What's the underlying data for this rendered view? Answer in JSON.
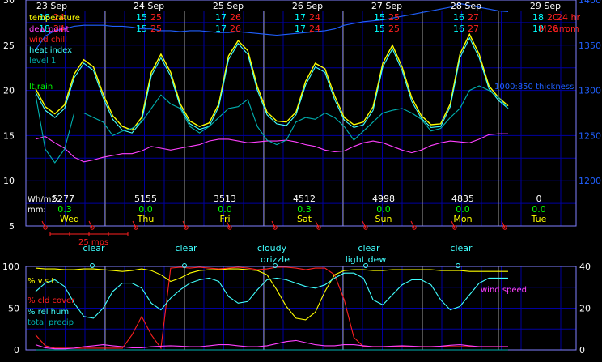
{
  "colors": {
    "background": "#000000",
    "frame": "#8080ff",
    "grid": "#0000a0",
    "day_line": "#a0a0a0",
    "temperature": "#ffff00",
    "dew_point": "#ff40ff",
    "wind_chill": "#ff2020",
    "heat_index": "#40ffff",
    "level1": "#00b0b0",
    "rain": "#00ff00",
    "thickness": "#2060ff",
    "tick_label": "#ffffff",
    "day_label": "#ffff00",
    "min_temp": "#00ffff",
    "max_temp": "#ff2020",
    "cloud_label": "#40ffff"
  },
  "chart_data": [
    {
      "type": "line",
      "title": "",
      "x_days": [
        "23 Sep",
        "24 Sep",
        "25 Sep",
        "26 Sep",
        "27 Sep",
        "28 Sep",
        "29 Sep"
      ],
      "ylim_left": [
        5,
        30
      ],
      "ylim_right": [
        1150,
        1400
      ],
      "left_ticks": [
        "5",
        "10",
        "15",
        "20",
        "25",
        "30"
      ],
      "right_ticks": [
        "1200",
        "1250",
        "1300",
        "1350",
        "1400"
      ],
      "legend": [
        "temperature",
        "dew point",
        "wind chill",
        "heat index",
        "level 1"
      ],
      "rain_label": "lt.rain",
      "thickness_label": "1000:850 thickness",
      "grid": true,
      "daily_min": [
        "18",
        "15",
        "17",
        "17",
        "15",
        "16",
        "18"
      ],
      "daily_max": [
        "24",
        "25",
        "26",
        "24",
        "25",
        "27",
        "20"
      ],
      "hour_modes": [
        "24 hr",
        "M",
        "am",
        "pm"
      ],
      "series": [
        {
          "name": "temperature",
          "values": [
            20.2,
            18.2,
            17.4,
            18.4,
            21.8,
            23.4,
            22.6,
            19.6,
            17.2,
            16.0,
            15.6,
            17.0,
            22.0,
            24.0,
            22.0,
            18.5,
            16.6,
            16.0,
            16.4,
            18.5,
            23.8,
            25.5,
            24.4,
            20.4,
            17.6,
            16.6,
            16.5,
            17.6,
            21.0,
            23.0,
            22.4,
            19.4,
            17.0,
            16.2,
            16.5,
            18.2,
            23.0,
            25.0,
            22.6,
            19.2,
            17.2,
            16.2,
            16.3,
            18.5,
            24.0,
            26.2,
            24.0,
            20.5,
            19.2,
            18.3
          ]
        },
        {
          "name": "dew point",
          "values": [
            14.6,
            14.9,
            14.2,
            13.6,
            12.6,
            12.1,
            12.3,
            12.6,
            12.8,
            13.0,
            13.0,
            13.3,
            13.8,
            13.6,
            13.4,
            13.6,
            13.8,
            14.0,
            14.4,
            14.6,
            14.6,
            14.4,
            14.2,
            14.3,
            14.4,
            14.4,
            14.5,
            14.3,
            14.0,
            13.8,
            13.4,
            13.2,
            13.3,
            13.8,
            14.2,
            14.4,
            14.2,
            13.8,
            13.4,
            13.1,
            13.4,
            13.9,
            14.2,
            14.4,
            14.3,
            14.2,
            14.6,
            15.1,
            15.2,
            15.2
          ]
        },
        {
          "name": "heat index",
          "values": [
            19.8,
            17.8,
            17.0,
            18.0,
            21.4,
            23.0,
            22.2,
            19.2,
            16.8,
            15.6,
            15.3,
            16.6,
            21.6,
            23.6,
            21.6,
            18.2,
            16.3,
            15.7,
            16.0,
            18.2,
            23.4,
            25.2,
            24.0,
            20.0,
            17.3,
            16.3,
            16.1,
            17.3,
            20.6,
            22.6,
            22.0,
            19.0,
            16.7,
            15.9,
            16.2,
            17.8,
            22.6,
            24.6,
            22.2,
            18.8,
            16.9,
            15.9,
            16.0,
            18.2,
            23.6,
            25.8,
            23.6,
            20.2,
            18.9,
            18.0
          ]
        },
        {
          "name": "level 1",
          "values": [
            19.5,
            13.5,
            12.0,
            13.5,
            17.5,
            17.5,
            17.0,
            16.5,
            15.0,
            15.5,
            15.8,
            16.5,
            18.0,
            19.5,
            18.5,
            18.0,
            16.0,
            15.3,
            16.0,
            17.0,
            18.0,
            18.2,
            19.0,
            16.0,
            14.5,
            14.0,
            14.5,
            16.5,
            17.0,
            16.8,
            17.5,
            17.0,
            16.0,
            14.5,
            15.5,
            16.5,
            17.5,
            17.8,
            18.0,
            17.5,
            16.8,
            15.5,
            15.8,
            17.0,
            18.0,
            20.0,
            20.5,
            20.0,
            19.2,
            18.0
          ]
        },
        {
          "name": "1000:850 thickness",
          "values": [
            1345,
            1360,
            1366,
            1368,
            1371,
            1372,
            1372,
            1372,
            1371,
            1371,
            1370,
            1368,
            1368,
            1366,
            1366,
            1365,
            1366,
            1366,
            1365,
            1364,
            1364,
            1365,
            1364,
            1363,
            1362,
            1361,
            1362,
            1363,
            1364,
            1365,
            1366,
            1368,
            1372,
            1374,
            1376,
            1377,
            1378,
            1380,
            1382,
            1384,
            1386,
            1388,
            1390,
            1392,
            1396,
            1394,
            1392,
            1390,
            1388,
            1387
          ]
        }
      ],
      "wind": {
        "label": "25 mps"
      },
      "rows": [
        {
          "label": "Wh/m2:",
          "values": [
            "5277",
            "5155",
            "3513",
            "4512",
            "4998",
            "4835",
            "0"
          ]
        },
        {
          "label": "mm:",
          "values": [
            "0.3",
            "0.0",
            "0.0",
            "0.3",
            "0.0",
            "0.0",
            "0.0"
          ]
        }
      ],
      "weekdays": [
        "Wed",
        "Thu",
        "Fri",
        "Sat",
        "Sun",
        "Mon",
        "Tue"
      ]
    },
    {
      "type": "line",
      "title": "",
      "ylim_left": [
        0,
        100
      ],
      "ylim_right": [
        0,
        40
      ],
      "left_ticks": [
        "0",
        "50",
        "100"
      ],
      "right_ticks": [
        "0",
        "20",
        "40"
      ],
      "legend": [
        "% v.s.t.",
        "% cld cover",
        "% rel hum",
        "total precip"
      ],
      "right_series_label": "wind speed",
      "cloud_labels": [
        "clear",
        "clear",
        "cloudy",
        "drizzle",
        "clear",
        "light dew",
        "clear"
      ],
      "series": [
        {
          "name": "% v.s.t.",
          "values": [
            98,
            97,
            97,
            96,
            96,
            97,
            97,
            96,
            95,
            94,
            95,
            97,
            95,
            90,
            82,
            86,
            92,
            95,
            96,
            96,
            97,
            97,
            96,
            95,
            90,
            72,
            52,
            38,
            36,
            45,
            70,
            90,
            95,
            96,
            96,
            95,
            95,
            96,
            96,
            96,
            96,
            96,
            95,
            95,
            95,
            94,
            94,
            94,
            94,
            94
          ]
        },
        {
          "name": "% cld cover",
          "values": [
            18,
            5,
            2,
            2,
            2,
            2,
            2,
            2,
            2,
            2,
            18,
            40,
            18,
            2,
            98,
            99,
            98,
            99,
            98,
            97,
            98,
            99,
            98,
            96,
            97,
            99,
            99,
            98,
            96,
            98,
            98,
            90,
            60,
            15,
            4,
            4,
            4,
            4,
            4,
            4,
            4,
            4,
            4,
            4,
            4,
            4,
            4,
            4,
            4,
            4
          ]
        },
        {
          "name": "% rel hum",
          "values": [
            70,
            80,
            84,
            76,
            56,
            40,
            38,
            50,
            70,
            80,
            80,
            74,
            56,
            48,
            62,
            72,
            80,
            84,
            86,
            82,
            64,
            56,
            58,
            72,
            84,
            86,
            84,
            80,
            76,
            74,
            78,
            86,
            92,
            92,
            86,
            60,
            54,
            66,
            78,
            84,
            84,
            78,
            60,
            48,
            52,
            66,
            80,
            86,
            86,
            86
          ]
        },
        {
          "name": "total precip",
          "values": [
            0,
            0,
            0,
            0,
            0,
            0,
            0,
            0,
            0,
            0,
            0,
            0,
            0,
            0,
            0,
            0,
            0,
            0,
            0,
            0,
            0,
            0,
            0,
            0,
            0,
            0,
            0,
            0,
            0,
            0,
            0,
            0,
            0,
            0,
            0,
            0,
            0,
            0,
            0,
            0,
            0,
            0,
            0,
            0,
            0,
            0,
            0,
            0,
            0,
            0
          ]
        },
        {
          "name": "wind speed",
          "values": [
            2.5,
            1,
            0.5,
            0.5,
            0.8,
            1.5,
            2,
            2.5,
            2,
            1.5,
            1,
            1,
            1.5,
            1.8,
            2,
            1.8,
            1.5,
            1.5,
            2,
            2.5,
            2.5,
            2,
            1.5,
            1.5,
            2,
            3,
            4,
            4.5,
            3.5,
            2.5,
            2,
            2,
            2.5,
            2.5,
            2,
            1.5,
            1.5,
            1.8,
            2,
            1.8,
            1.5,
            1.5,
            1.8,
            2.2,
            2.5,
            2,
            1.5,
            1.5,
            1.5,
            1.5
          ]
        }
      ]
    }
  ]
}
